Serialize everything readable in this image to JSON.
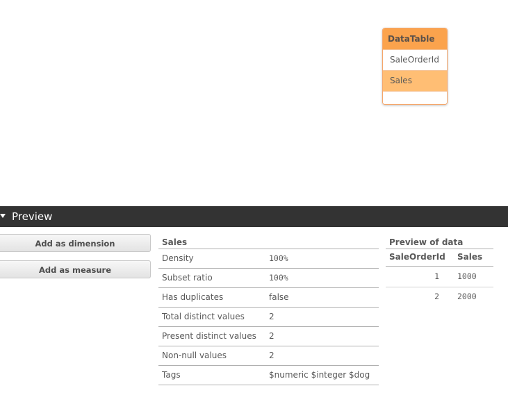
{
  "model": {
    "table_title": "DataTable",
    "fields": [
      "SaleOrderId",
      "Sales"
    ],
    "selected_field": "Sales"
  },
  "preview": {
    "title": "Preview",
    "buttons": {
      "add_dimension": "Add as dimension",
      "add_measure": "Add as measure"
    },
    "field": {
      "name": "Sales",
      "properties": [
        {
          "label": "Density",
          "value": "100%"
        },
        {
          "label": "Subset ratio",
          "value": "100%"
        },
        {
          "label": "Has duplicates",
          "value": "false"
        },
        {
          "label": "Total distinct values",
          "value": "2"
        },
        {
          "label": "Present distinct values",
          "value": "2"
        },
        {
          "label": "Non-null values",
          "value": "2"
        },
        {
          "label": "Tags",
          "value": "$numeric $integer $dog"
        }
      ]
    },
    "data_preview": {
      "title": "Preview of data",
      "columns": [
        "SaleOrderId",
        "Sales"
      ],
      "rows": [
        [
          "1",
          "1000"
        ],
        [
          "2",
          "2000"
        ]
      ]
    }
  },
  "colors": {
    "table_header": "#fba34d",
    "selected_field": "#ffbe74",
    "preview_bar": "#333333"
  }
}
